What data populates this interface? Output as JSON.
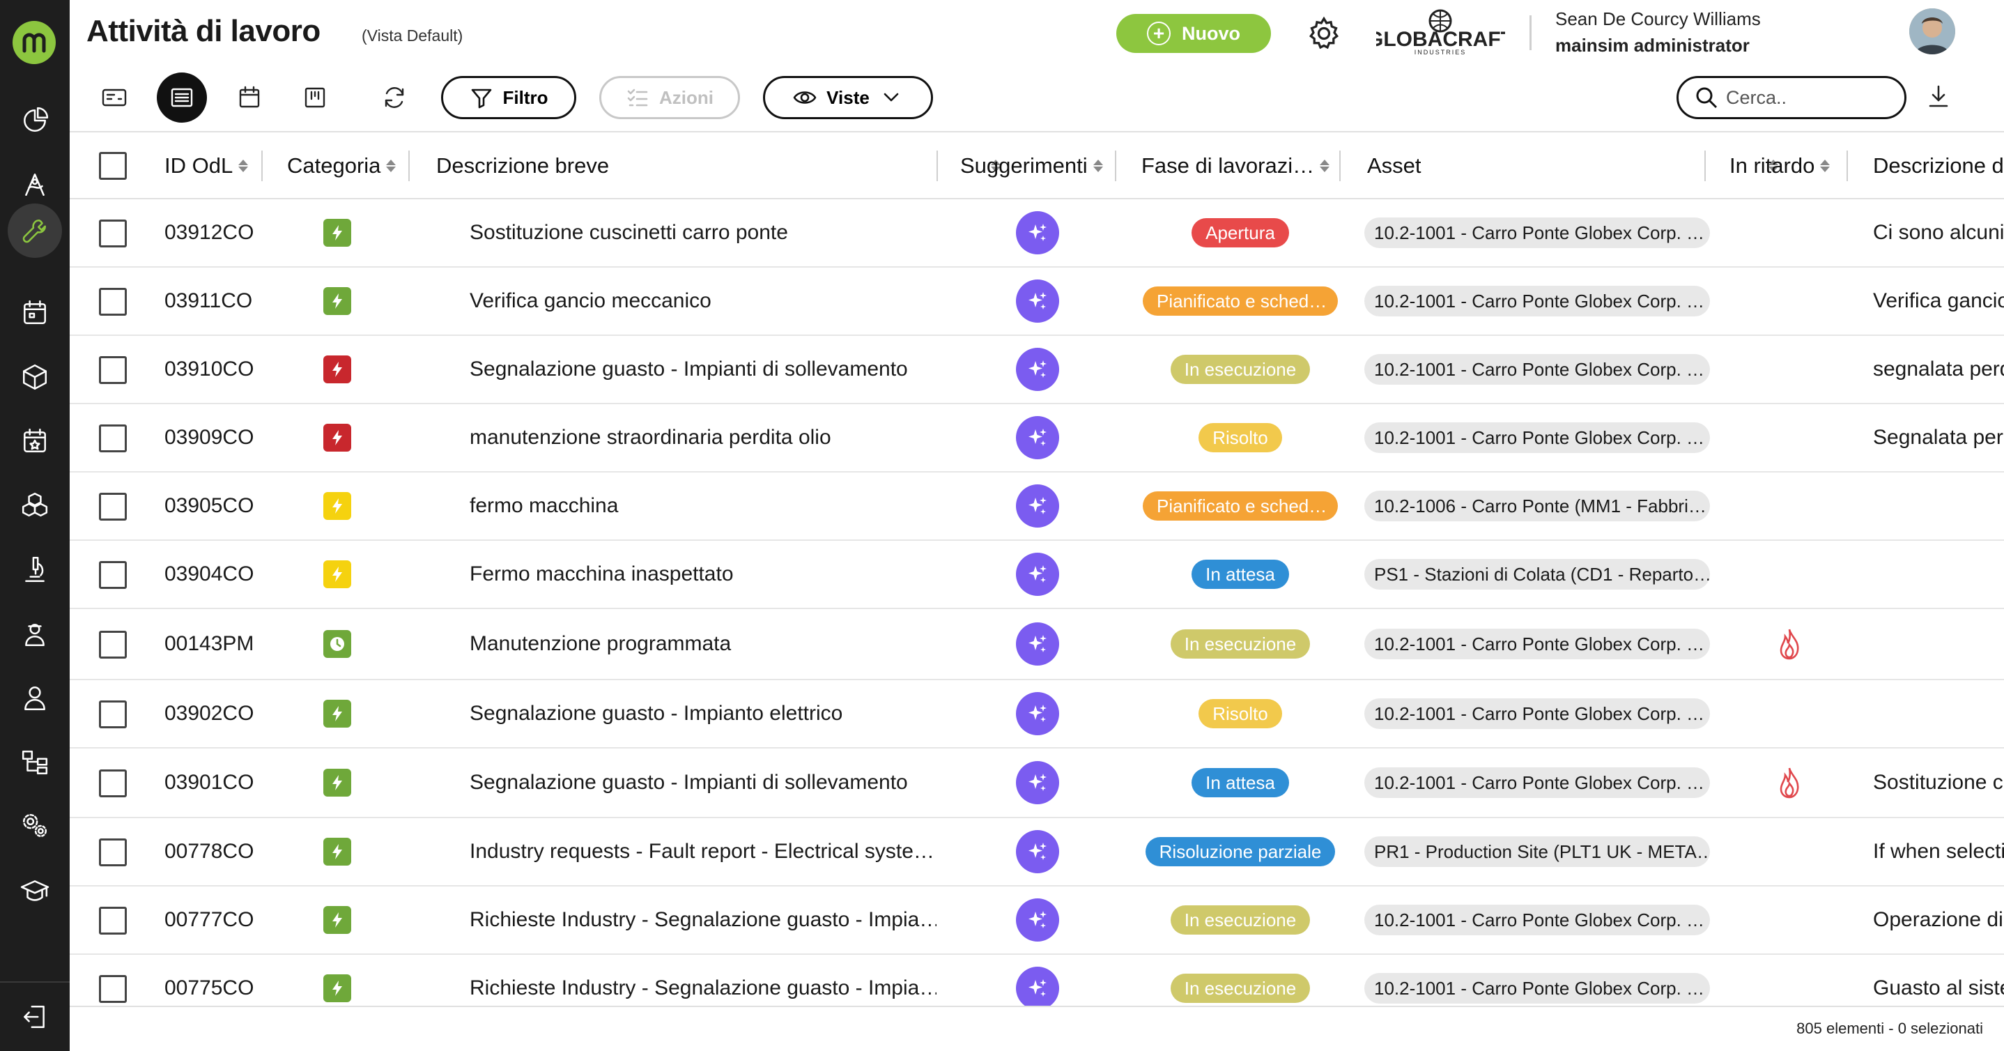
{
  "header": {
    "title": "Attività di lavoro",
    "subtitle": "(Vista Default)",
    "new_label": "Nuovo",
    "company_name": "GLOBACRAFT",
    "company_sub": "INDUSTRIES",
    "user_name": "Sean De Courcy Williams",
    "user_role": "mainsim administrator"
  },
  "toolbar": {
    "filter_label": "Filtro",
    "actions_label": "Azioni",
    "views_label": "Viste",
    "search_placeholder": "Cerca.."
  },
  "columns": {
    "id": "ID OdL",
    "category": "Categoria",
    "description": "Descrizione breve",
    "suggestions": "Suggerimenti",
    "phase": "Fase di lavorazi…",
    "asset": "Asset",
    "late": "In ritardo",
    "long_description": "Descrizione d"
  },
  "rows": [
    {
      "id": "03912CO",
      "cat_color": "#6fa83a",
      "cat_icon": "bolt-icon",
      "desc": "Sostituzione cuscinetti carro ponte",
      "phase": "Apertura",
      "phase_color": "#e84a4a",
      "asset": "10.2-1001 - Carro Ponte Globex Corp. …",
      "late": false,
      "long": "Ci sono alcuni"
    },
    {
      "id": "03911CO",
      "cat_color": "#6fa83a",
      "cat_icon": "bolt-icon",
      "desc": "Verifica gancio meccanico",
      "phase": "Pianificato e sched…",
      "phase_color": "#f5a335",
      "asset": "10.2-1001 - Carro Ponte Globex Corp. …",
      "late": false,
      "long": "Verifica gancio"
    },
    {
      "id": "03910CO",
      "cat_color": "#c8272d",
      "cat_icon": "bolt-icon",
      "desc": "Segnalazione guasto - Impianti di sollevamento",
      "phase": "In esecuzione",
      "phase_color": "#cfc96a",
      "asset": "10.2-1001 - Carro Ponte Globex Corp. …",
      "late": false,
      "long": "segnalata perd"
    },
    {
      "id": "03909CO",
      "cat_color": "#c8272d",
      "cat_icon": "bolt-icon",
      "desc": "manutenzione straordinaria perdita olio",
      "phase": "Risolto",
      "phase_color": "#f2c94c",
      "asset": "10.2-1001 - Carro Ponte Globex Corp. …",
      "late": false,
      "long": "Segnalata perd"
    },
    {
      "id": "03905CO",
      "cat_color": "#f5d20f",
      "cat_icon": "bolt-icon",
      "desc": "fermo macchina",
      "phase": "Pianificato e sched…",
      "phase_color": "#f5a335",
      "asset": "10.2-1006 - Carro Ponte (MM1 - Fabbri…",
      "late": false,
      "long": ""
    },
    {
      "id": "03904CO",
      "cat_color": "#f5d20f",
      "cat_icon": "bolt-icon",
      "desc": "Fermo macchina inaspettato",
      "phase": "In attesa",
      "phase_color": "#2f8fd6",
      "asset": "PS1 - Stazioni di Colata (CD1 - Reparto…",
      "late": false,
      "long": ""
    },
    {
      "id": "00143PM",
      "cat_color": "#6fa83a",
      "cat_icon": "clock-icon",
      "desc": "Manutenzione programmata",
      "phase": "In esecuzione",
      "phase_color": "#cfc96a",
      "asset": "10.2-1001 - Carro Ponte Globex Corp. …",
      "late": true,
      "long": ""
    },
    {
      "id": "03902CO",
      "cat_color": "#6fa83a",
      "cat_icon": "bolt-icon",
      "desc": "Segnalazione guasto - Impianto elettrico",
      "phase": "Risolto",
      "phase_color": "#f2c94c",
      "asset": "10.2-1001 - Carro Ponte Globex Corp. …",
      "late": false,
      "long": ""
    },
    {
      "id": "03901CO",
      "cat_color": "#6fa83a",
      "cat_icon": "bolt-icon",
      "desc": "Segnalazione guasto - Impianti di sollevamento",
      "phase": "In attesa",
      "phase_color": "#2f8fd6",
      "asset": "10.2-1001 - Carro Ponte Globex Corp. …",
      "late": true,
      "long": "Sostituzione c"
    },
    {
      "id": "00778CO",
      "cat_color": "#6fa83a",
      "cat_icon": "bolt-icon",
      "desc": "Industry requests - Fault report - Electrical syste…",
      "phase": "Risoluzione parziale",
      "phase_color": "#2f8fd6",
      "asset": "PR1 - Production Site (PLT1 UK - META…",
      "late": false,
      "long": "If when selecti"
    },
    {
      "id": "00777CO",
      "cat_color": "#6fa83a",
      "cat_icon": "bolt-icon",
      "desc": "Richieste Industry - Segnalazione guasto - Impia…",
      "phase": "In esecuzione",
      "phase_color": "#cfc96a",
      "asset": "10.2-1001 - Carro Ponte Globex Corp. …",
      "late": false,
      "long": "Operazione di"
    },
    {
      "id": "00775CO",
      "cat_color": "#6fa83a",
      "cat_icon": "bolt-icon",
      "desc": "Richieste Industry - Segnalazione guasto - Impia…",
      "phase": "In esecuzione",
      "phase_color": "#cfc96a",
      "asset": "10.2-1001 - Carro Ponte Globex Corp. …",
      "late": false,
      "long": "Guasto al siste"
    }
  ],
  "footer": {
    "status": "805 elementi - 0 selezionati"
  }
}
